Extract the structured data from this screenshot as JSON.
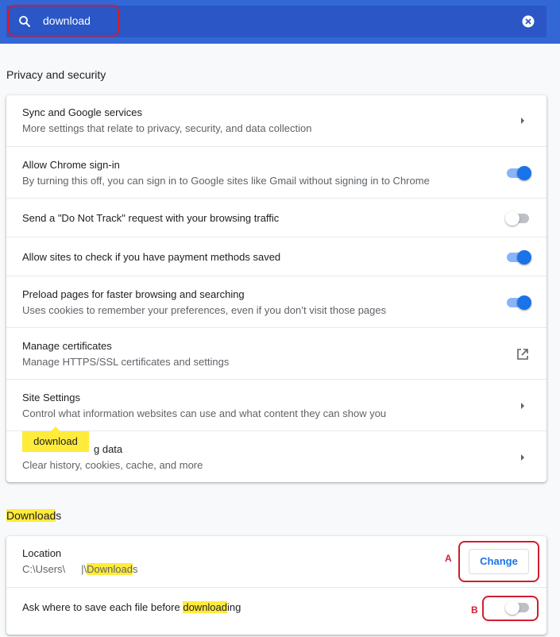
{
  "search": {
    "value": "download"
  },
  "privacy": {
    "title": "Privacy and security",
    "rows": [
      {
        "title": "Sync and Google services",
        "subtitle": "More settings that relate to privacy, security, and data collection",
        "control": "arrow"
      },
      {
        "title": "Allow Chrome sign-in",
        "subtitle": "By turning this off, you can sign in to Google sites like Gmail without signing in to Chrome",
        "control": "toggle",
        "on": true
      },
      {
        "title": "Send a \"Do Not Track\" request with your browsing traffic",
        "control": "toggle",
        "on": false
      },
      {
        "title": "Allow sites to check if you have payment methods saved",
        "control": "toggle",
        "on": true
      },
      {
        "title": "Preload pages for faster browsing and searching",
        "subtitle": "Uses cookies to remember your preferences, even if you don’t visit those pages",
        "control": "toggle",
        "on": true
      },
      {
        "title": "Manage certificates",
        "subtitle": "Manage HTTPS/SSL certificates and settings",
        "control": "external"
      },
      {
        "title": "Site Settings",
        "subtitle": "Control what information websites can use and what content they can show you",
        "control": "arrow"
      },
      {
        "title_visible": "g data",
        "subtitle": "Clear history, cookies, cache, and more",
        "control": "arrow"
      }
    ],
    "bubble": "download"
  },
  "downloads": {
    "title_highlight": "Download",
    "title_rest": "s",
    "location": {
      "label": "Location",
      "path_prefix": "C:\\Users\\",
      "path_mid": "|\\",
      "path_highlight": "Download",
      "path_suffix": "s",
      "change_label": "Change"
    },
    "ask": {
      "text_before": "Ask where to save each file before ",
      "text_highlight": "download",
      "text_after": "ing",
      "on": false
    }
  },
  "annotations": {
    "a": "A",
    "b": "B"
  },
  "colors": {
    "header": "#3367d6",
    "accent": "#1a73e8",
    "highlight": "#ffeb3b",
    "annotation": "#d11d2f"
  }
}
